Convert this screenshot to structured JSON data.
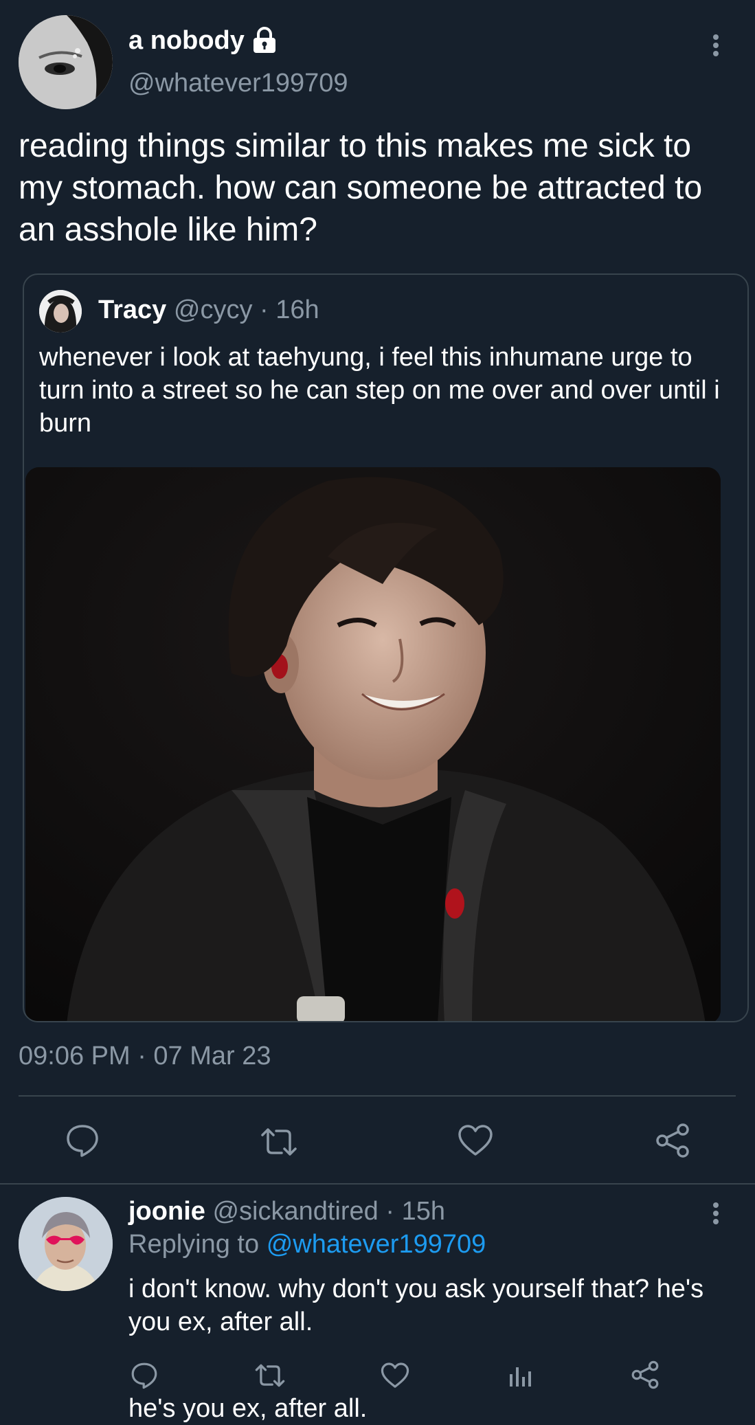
{
  "main_tweet": {
    "author_name": "a nobody",
    "author_handle": "@whatever199709",
    "text": "reading things similar to this makes me sick to my stomach. how can someone be attracted to an asshole like him?",
    "timestamp": "09:06 PM · 07 Mar 23",
    "lock_icon": "lock-icon",
    "more_icon": "more-vertical-icon"
  },
  "quoted_tweet": {
    "author_name": "Tracy",
    "author_handle": "@cycy",
    "separator": "·",
    "time": "16h",
    "text": "whenever i look at taehyung, i feel this inhumane urge to turn into a street so he can step on me over and over until i burn"
  },
  "actions": {
    "icons": [
      "reply-icon",
      "retweet-icon",
      "like-icon",
      "share-icon"
    ]
  },
  "reply": {
    "author_name": "joonie",
    "author_handle": "@sickandtired",
    "separator": "·",
    "time": "15h",
    "replying_prefix": "Replying to",
    "replying_to": "@whatever199709",
    "text": "i don't know. why don't you ask yourself that? he's you ex, after all.",
    "overflow_text": "he's you ex, after all.",
    "icons": [
      "reply-icon",
      "retweet-icon",
      "like-icon",
      "analytics-icon",
      "share-icon"
    ]
  },
  "colors": {
    "background": "#16202c",
    "text": "#ffffff",
    "muted": "#8b98a5",
    "link": "#1d9bf0",
    "border": "#38444d"
  }
}
